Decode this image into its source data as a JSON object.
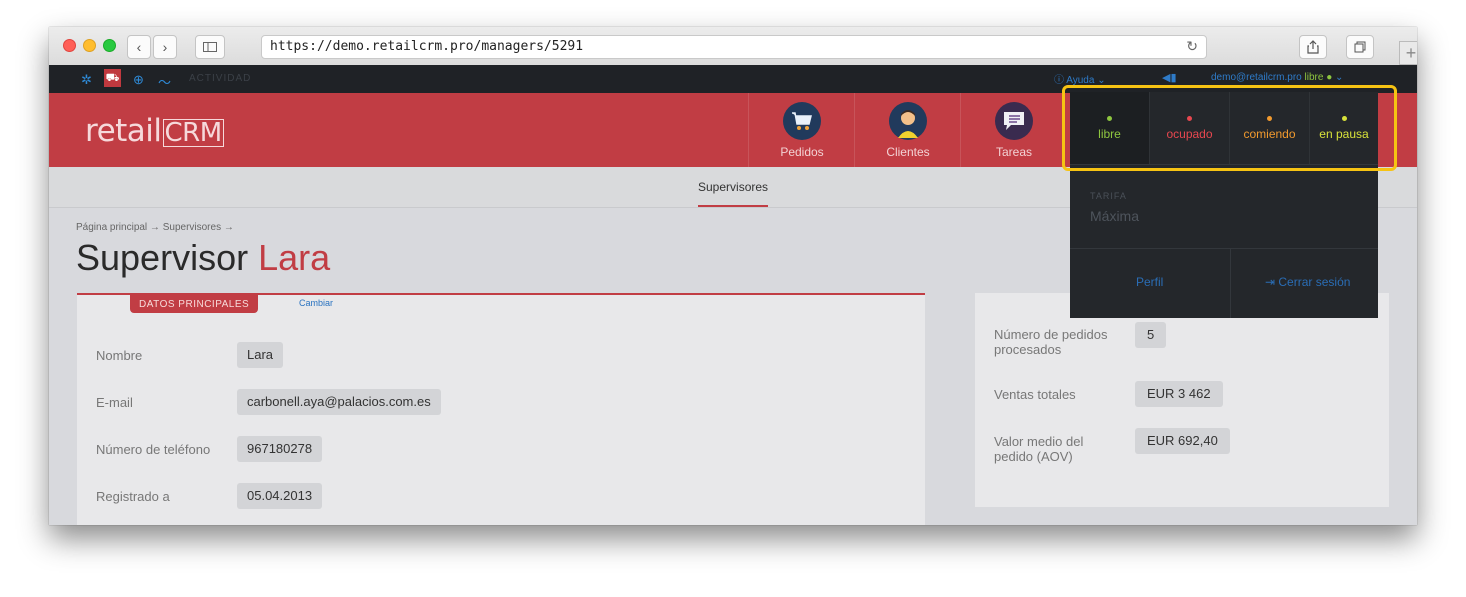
{
  "browser": {
    "url": "https://demo.retailcrm.pro/managers/5291",
    "back_glyph": "‹",
    "forward_glyph": "›",
    "new_tab_glyph": "+"
  },
  "topbar": {
    "activity": "ACTIVIDAD",
    "help": "Ayuda",
    "user_email": "demo@retailcrm.pro",
    "user_status": "libre"
  },
  "header": {
    "logo_text": "retail",
    "logo_boxed": "CRM",
    "nav": [
      {
        "label": "Pedidos",
        "icon": "cart-icon"
      },
      {
        "label": "Clientes",
        "icon": "person-icon"
      },
      {
        "label": "Tareas",
        "icon": "chat-icon"
      }
    ]
  },
  "subnav": {
    "tab": "Supervisores"
  },
  "breadcrumb": "Página principal → Supervisores →",
  "title": {
    "prefix": "Supervisor",
    "name": "Lara"
  },
  "main_card": {
    "tab": "DATOS PRINCIPALES",
    "change": "Cambiar",
    "rows": [
      {
        "label": "Nombre",
        "value": "Lara"
      },
      {
        "label": "E-mail",
        "value": "carbonell.aya@palacios.com.es"
      },
      {
        "label": "Número de teléfono",
        "value": "967180278"
      },
      {
        "label": "Registrado a",
        "value": "05.04.2013"
      }
    ]
  },
  "stats_card": {
    "rows": [
      {
        "label": "Número de pedidos procesados",
        "value": "5"
      },
      {
        "label": "Ventas totales",
        "value": "EUR 3 462"
      },
      {
        "label": "Valor medio del pedido (AOV)",
        "value": "EUR 692,40"
      }
    ]
  },
  "dropdown": {
    "statuses": [
      {
        "label": "libre",
        "color": "#8ec63f"
      },
      {
        "label": "ocupado",
        "color": "#e8474f"
      },
      {
        "label": "comiendo",
        "color": "#f29a2e"
      },
      {
        "label": "en pausa",
        "color": "#d8e23a"
      }
    ],
    "tarifa_label": "TARIFA",
    "tarifa_value": "Máxima",
    "profile": "Perfil",
    "logout": "Cerrar sesión"
  },
  "colors": {
    "brand_red": "#c13d44",
    "highlight": "#f6c313",
    "link_blue": "#2a6db5"
  }
}
